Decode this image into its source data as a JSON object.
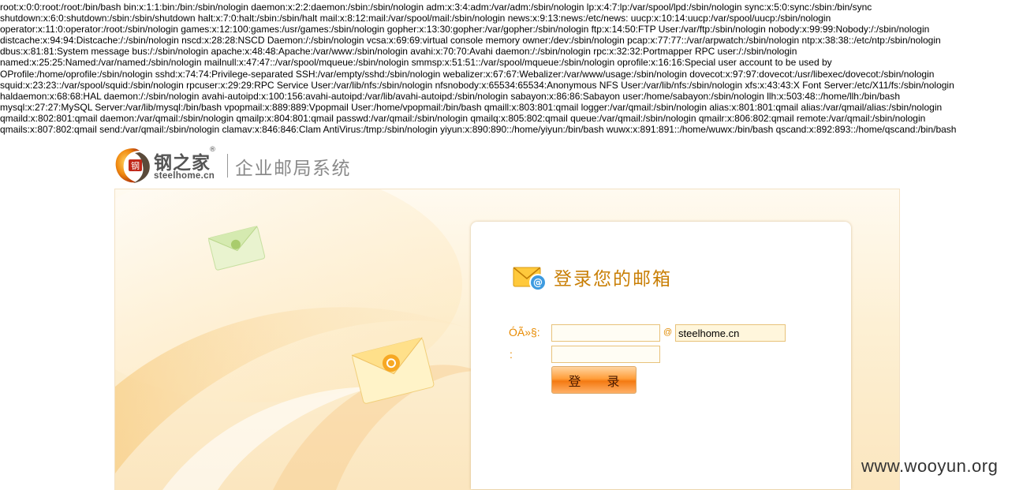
{
  "leaked_output": [
    "root:x:0:0:root:/root:/bin/bash bin:x:1:1:bin:/bin:/sbin/nologin daemon:x:2:2:daemon:/sbin:/sbin/nologin adm:x:3:4:adm:/var/adm:/sbin/nologin lp:x:4:7:lp:/var/spool/lpd:/sbin/nologin sync:x:5:0:sync:/sbin:/bin/sync",
    "shutdown:x:6:0:shutdown:/sbin:/sbin/shutdown halt:x:7:0:halt:/sbin:/sbin/halt mail:x:8:12:mail:/var/spool/mail:/sbin/nologin news:x:9:13:news:/etc/news: uucp:x:10:14:uucp:/var/spool/uucp:/sbin/nologin",
    "operator:x:11:0:operator:/root:/sbin/nologin games:x:12:100:games:/usr/games:/sbin/nologin gopher:x:13:30:gopher:/var/gopher:/sbin/nologin ftp:x:14:50:FTP User:/var/ftp:/sbin/nologin nobody:x:99:99:Nobody:/:/sbin/nologin",
    "distcache:x:94:94:Distcache:/:/sbin/nologin nscd:x:28:28:NSCD Daemon:/:/sbin/nologin vcsa:x:69:69:virtual console memory owner:/dev:/sbin/nologin pcap:x:77:77::/var/arpwatch:/sbin/nologin ntp:x:38:38::/etc/ntp:/sbin/nologin",
    "dbus:x:81:81:System message bus:/:/sbin/nologin apache:x:48:48:Apache:/var/www:/sbin/nologin avahi:x:70:70:Avahi daemon:/:/sbin/nologin rpc:x:32:32:Portmapper RPC user:/:/sbin/nologin",
    "named:x:25:25:Named:/var/named:/sbin/nologin mailnull:x:47:47::/var/spool/mqueue:/sbin/nologin smmsp:x:51:51::/var/spool/mqueue:/sbin/nologin oprofile:x:16:16:Special user account to be used by",
    "OProfile:/home/oprofile:/sbin/nologin sshd:x:74:74:Privilege-separated SSH:/var/empty/sshd:/sbin/nologin webalizer:x:67:67:Webalizer:/var/www/usage:/sbin/nologin dovecot:x:97:97:dovecot:/usr/libexec/dovecot:/sbin/nologin",
    "squid:x:23:23::/var/spool/squid:/sbin/nologin rpcuser:x:29:29:RPC Service User:/var/lib/nfs:/sbin/nologin nfsnobody:x:65534:65534:Anonymous NFS User:/var/lib/nfs:/sbin/nologin xfs:x:43:43:X Font Server:/etc/X11/fs:/sbin/nologin",
    "haldaemon:x:68:68:HAL daemon:/:/sbin/nologin avahi-autoipd:x:100:156:avahi-autoipd:/var/lib/avahi-autoipd:/sbin/nologin sabayon:x:86:86:Sabayon user:/home/sabayon:/sbin/nologin llh:x:503:48::/home/llh:/bin/bash",
    "mysql:x:27:27:MySQL Server:/var/lib/mysql:/bin/bash vpopmail:x:889:889:Vpopmail User:/home/vpopmail:/bin/bash qmaill:x:803:801:qmail logger:/var/qmail:/sbin/nologin alias:x:801:801:qmail alias:/var/qmail/alias:/sbin/nologin",
    "qmaild:x:802:801:qmail daemon:/var/qmail:/sbin/nologin qmailp:x:804:801:qmail passwd:/var/qmail:/sbin/nologin qmailq:x:805:802:qmail queue:/var/qmail:/sbin/nologin qmailr:x:806:802:qmail remote:/var/qmail:/sbin/nologin",
    "qmails:x:807:802:qmail send:/var/qmail:/sbin/nologin clamav:x:846:846:Clam AntiVirus:/tmp:/sbin/nologin yiyun:x:890:890::/home/yiyun:/bin/bash wuwx:x:891:891::/home/wuwx:/bin/bash qscand:x:892:893::/home/qscand:/bin/bash"
  ],
  "header": {
    "logo_seal_text": "钢",
    "brand_cn": "钢之家",
    "brand_reg": "®",
    "brand_en": "steelhome.cn",
    "system_title": "企业邮局系统"
  },
  "login": {
    "title": "登录您的邮箱",
    "username_label": "ÓÃ»§:",
    "username_value": "",
    "at_sign": "@",
    "domain_value": "steelhome.cn",
    "password_label": ":",
    "password_value": "",
    "submit_label": "登 录"
  },
  "watermark": "www.wooyun.org",
  "colors": {
    "accent_orange": "#e88a00",
    "title_orange": "#c97f06",
    "button_orange": "#f47a12",
    "logo_red": "#c0281a"
  },
  "icons": [
    "mail-at-icon",
    "logo-emblem-icon",
    "green-envelope-icon",
    "yellow-envelope-icon"
  ]
}
